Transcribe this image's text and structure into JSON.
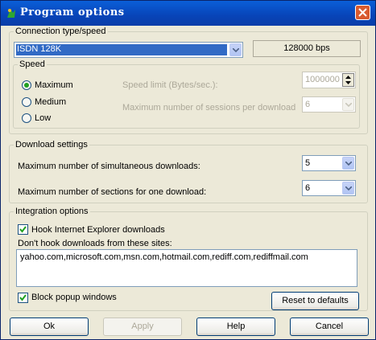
{
  "window": {
    "title": "Program options",
    "close_icon": "close-icon"
  },
  "connection": {
    "legend": "Connection type/speed",
    "selected_type": "ISDN 128K",
    "speed_readout": "128000 bps"
  },
  "speed": {
    "legend": "Speed",
    "options": [
      "Maximum",
      "Medium",
      "Low"
    ],
    "selected": "Maximum",
    "limit_label": "Speed limit (Bytes/sec.):",
    "limit_value": "1000000",
    "max_sessions_label": "Maximum number of sessions per download",
    "max_sessions_value": "6"
  },
  "download_settings": {
    "legend": "Download settings",
    "simultaneous_label": "Maximum number of simultaneous downloads:",
    "simultaneous_value": "5",
    "sections_label": "Maximum number of sections for one download:",
    "sections_value": "6"
  },
  "integration": {
    "legend": "Integration options",
    "hook_ie_label": "Hook Internet Explorer downloads",
    "hook_ie_checked": true,
    "dont_hook_label": "Don't hook downloads from these sites:",
    "sites": "yahoo.com,microsoft.com,msn.com,hotmail.com,rediff.com,rediffmail.com",
    "block_popup_label": "Block popup windows",
    "block_popup_checked": true,
    "reset_label": "Reset to defaults"
  },
  "buttons": {
    "ok": "Ok",
    "apply": "Apply",
    "help": "Help",
    "cancel": "Cancel"
  },
  "colors": {
    "title_bar": "#0a46c0",
    "selection": "#316ac5",
    "window_bg": "#ece9d8"
  }
}
